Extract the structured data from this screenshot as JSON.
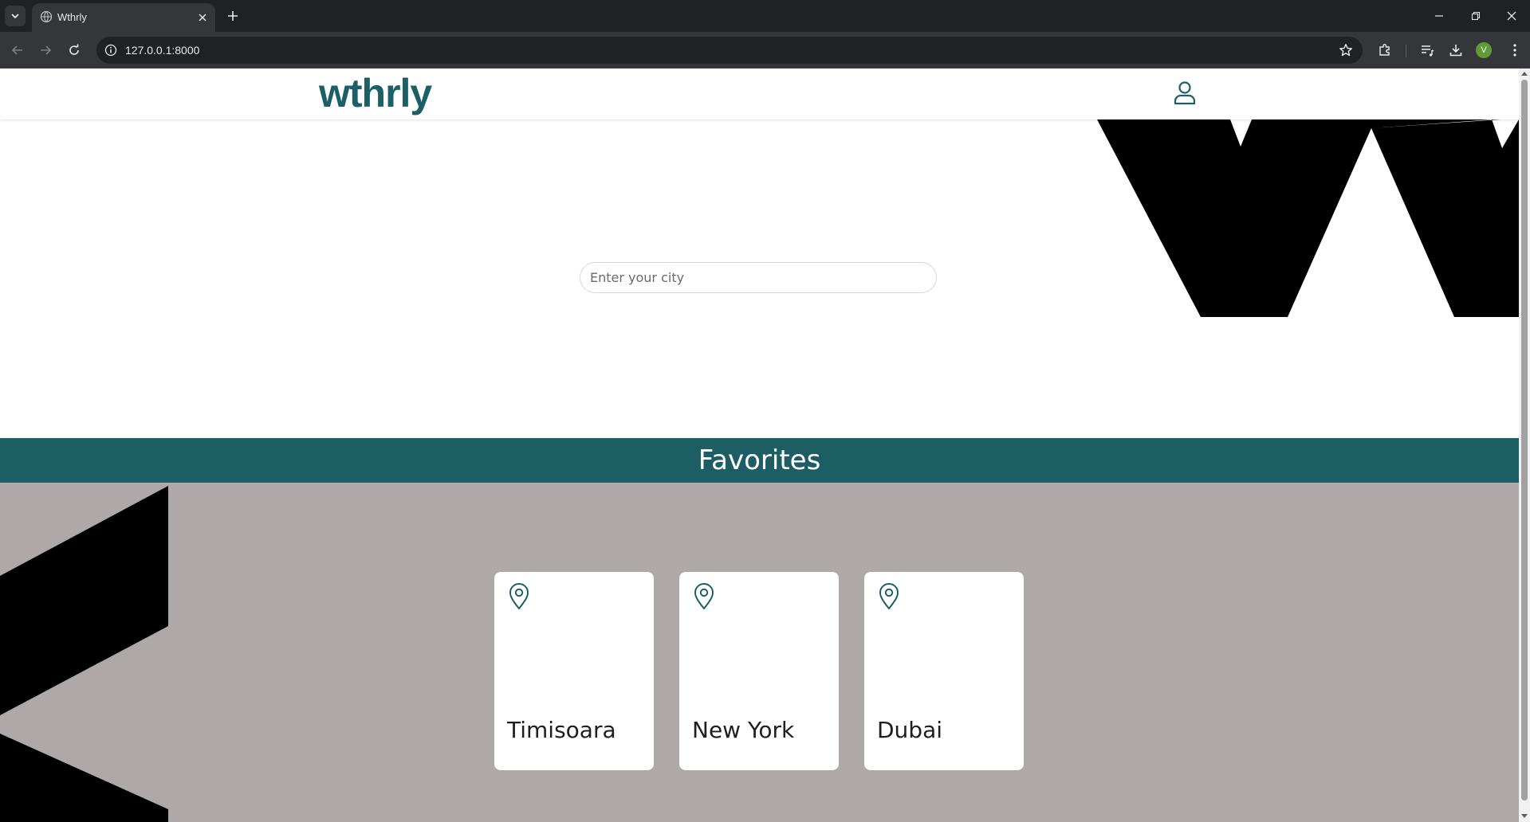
{
  "browser": {
    "tab_title": "Wthrly",
    "url": "127.0.0.1:8000",
    "profile_initial": "V"
  },
  "site": {
    "logo_text": "wthrly",
    "brand_color": "#1c5f66"
  },
  "search": {
    "placeholder": "Enter your city",
    "value": ""
  },
  "favorites": {
    "title": "Favorites",
    "band_color": "#1d5e65",
    "background_color": "#afa8a8",
    "cities": [
      {
        "name": "Timisoara",
        "icon": "location-pin-icon"
      },
      {
        "name": "New York",
        "icon": "location-pin-icon"
      },
      {
        "name": "Dubai",
        "icon": "location-pin-icon"
      }
    ]
  }
}
